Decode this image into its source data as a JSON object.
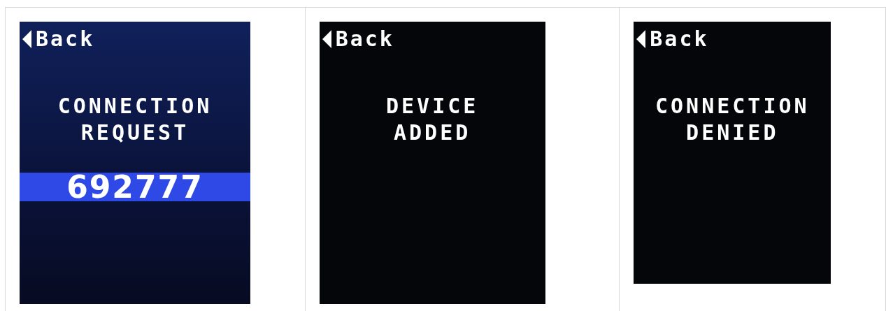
{
  "screens": [
    {
      "kind": "code",
      "back": "Back",
      "lines": [
        "CONNECTION",
        "REQUEST"
      ],
      "code": "692777"
    },
    {
      "kind": "message",
      "back": "Back",
      "lines": [
        "DEVICE",
        "ADDED"
      ]
    },
    {
      "kind": "message",
      "back": "Back",
      "lines": [
        "CONNECTION",
        "DENIED"
      ]
    }
  ]
}
